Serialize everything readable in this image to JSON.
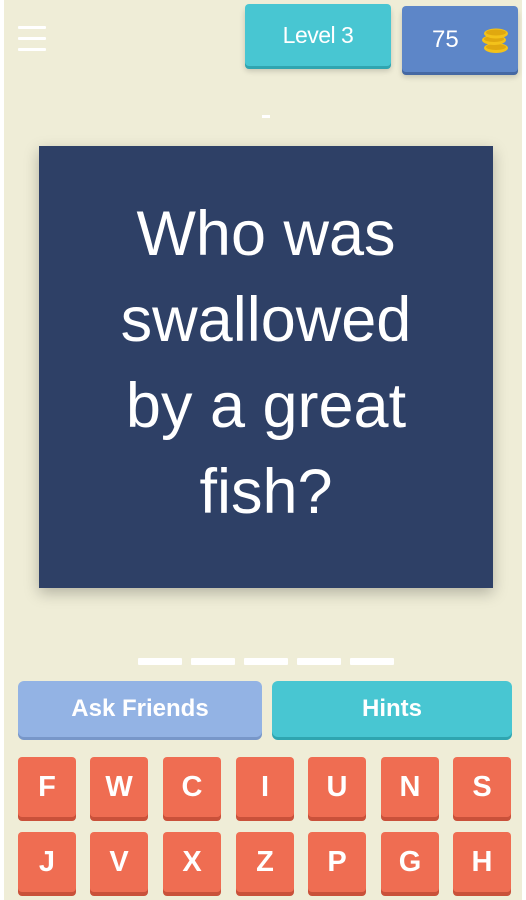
{
  "header": {
    "level_label": "Level 3",
    "coins": "75",
    "menu_icon": "hamburger-menu-icon",
    "coin_icon": "coin-stack-icon"
  },
  "question": {
    "lines": [
      "Who was",
      "swallowed",
      "by a great",
      "fish?"
    ]
  },
  "answer": {
    "slot_count": 5
  },
  "actions": {
    "ask_friends": "Ask Friends",
    "hints": "Hints"
  },
  "letters": {
    "row1": [
      "F",
      "W",
      "C",
      "I",
      "U",
      "N",
      "S"
    ],
    "row2": [
      "J",
      "V",
      "X",
      "Z",
      "P",
      "G",
      "H"
    ]
  },
  "colors": {
    "background": "#efedd7",
    "card": "#2e4066",
    "level": "#48c6d2",
    "coins": "#5d86c8",
    "ask_friends": "#93b3e4",
    "hints": "#48c6d2",
    "letter_tile": "#ef6d52",
    "coin": "#f3c21a"
  }
}
